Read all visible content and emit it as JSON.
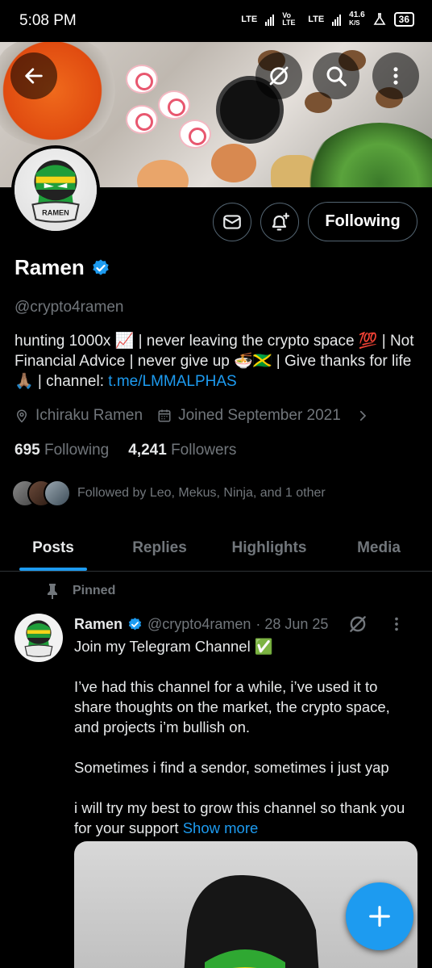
{
  "status_bar": {
    "time": "5:08 PM",
    "network1": "LTE",
    "network2": "Vo LTE",
    "network3": "LTE",
    "speed": "41.6",
    "speed_unit": "K/S",
    "battery": "36"
  },
  "header": {
    "back_icon": "arrow-left-icon",
    "grok_icon": "grok-icon",
    "search_icon": "search-icon",
    "more_icon": "more-vertical-icon"
  },
  "profile": {
    "name": "Ramen",
    "handle": "@crypto4ramen",
    "bio_text": "hunting 1000x 📈 | never leaving the crypto space 💯 | Not Financial Advice | never give up 🍜🇯🇲 | Give thanks for life 🙏🏽 | channel: ",
    "bio_link": "t.me/LMMALPHAS",
    "location": "Ichiraku Ramen",
    "joined": "Joined September 2021",
    "following_count": "695",
    "following_label": "Following",
    "followers_count": "4,241",
    "followers_label": "Followers",
    "followed_by": "Followed by Leo, Mekus, Ninja, and 1 other",
    "follow_button": "Following",
    "avatar_text": "RAMEN"
  },
  "tabs": [
    {
      "label": "Posts",
      "active": true
    },
    {
      "label": "Replies",
      "active": false
    },
    {
      "label": "Highlights",
      "active": false
    },
    {
      "label": "Media",
      "active": false
    }
  ],
  "pinned_post": {
    "pinned_label": "Pinned",
    "author": "Ramen",
    "handle": "@crypto4ramen",
    "date": "· 28 Jun 25",
    "paragraphs": [
      "Join my Telegram Channel ✅",
      "I’ve had this channel for a while, i’ve used it to share thoughts on the market, the crypto space, and projects i’m bullish on.",
      "Sometimes i find a sendor, sometimes i just yap",
      "i will try my best to grow this channel so thank you for your support "
    ],
    "show_more": "Show more"
  },
  "colors": {
    "accent": "#1d9bf0",
    "background": "#000000",
    "text_primary": "#e7e9ea",
    "text_secondary": "#71767b"
  }
}
